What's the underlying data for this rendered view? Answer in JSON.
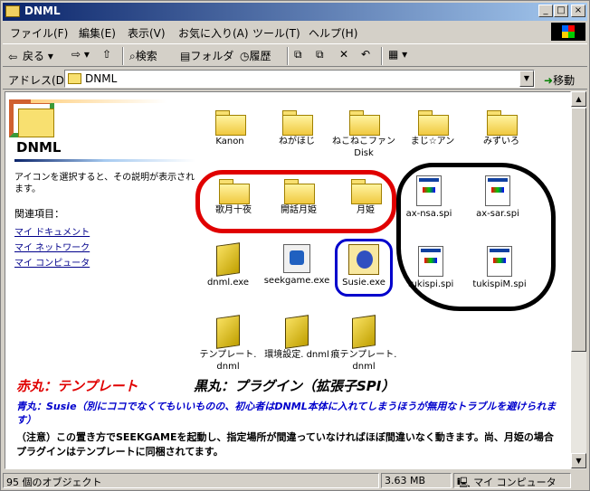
{
  "window": {
    "title": "DNML"
  },
  "menu": [
    "ファイル(F)",
    "編集(E)",
    "表示(V)",
    "お気に入り(A)",
    "ツール(T)",
    "ヘルプ(H)"
  ],
  "toolbar": {
    "back": "戻る",
    "search": "検索",
    "folders": "フォルダ",
    "history": "履歴"
  },
  "address": {
    "label": "アドレス(D)",
    "value": "DNML",
    "go": "移動"
  },
  "left_panel": {
    "title": "DNML",
    "description": "アイコンを選択すると、その説明が表示されます。",
    "related": "関連項目：",
    "links": [
      "マイ ドキュメント",
      "マイ ネットワーク",
      "マイ コンピュータ"
    ]
  },
  "items": {
    "kanon": "Kanon",
    "negahoji": "ねがほじ",
    "nekoneko": "ねこねこファン Disk",
    "maji": "まじ☆アン",
    "mizuiro": "みずいろ",
    "kagetsu": "歌月十夜",
    "kaidan": "開話月姫",
    "tsukihime": "月姫",
    "ax_nsa": "ax-nsa.spi",
    "ax_sar": "ax-sar.spi",
    "dnml_exe": "dnml.exe",
    "seekgame": "seekgame.exe",
    "susie": "Susie.exe",
    "tukispi": "tukispi.spi",
    "tukispim": "tukispiM.spi",
    "template": "テンプレート. dnml",
    "kankyo": "環境設定. dnml",
    "konseki": "痕テンプレート. dnml"
  },
  "annotations": {
    "red": "赤丸：テンプレート",
    "black": "黒丸：プラグイン（拡張子SPI）",
    "blue": "青丸：Susie（別にココでなくてもいいものの、初心者はDNML本体に入れてしまうほうが無用なトラブルを避けられます）",
    "note": "（注意）この置き方でSEEKGAMEを起動し、指定場所が間違っていなければほぼ間違いなく動きます。尚、月姫の場合プラグインはテンプレートに同梱されてます。"
  },
  "colors": {
    "red_ring": "#e00000",
    "black_ring": "#000000",
    "blue_ring": "#0000cc"
  },
  "status": {
    "objects": "95 個のオブジェクト",
    "size": "3.63 MB",
    "location": "マイ コンピュータ"
  }
}
